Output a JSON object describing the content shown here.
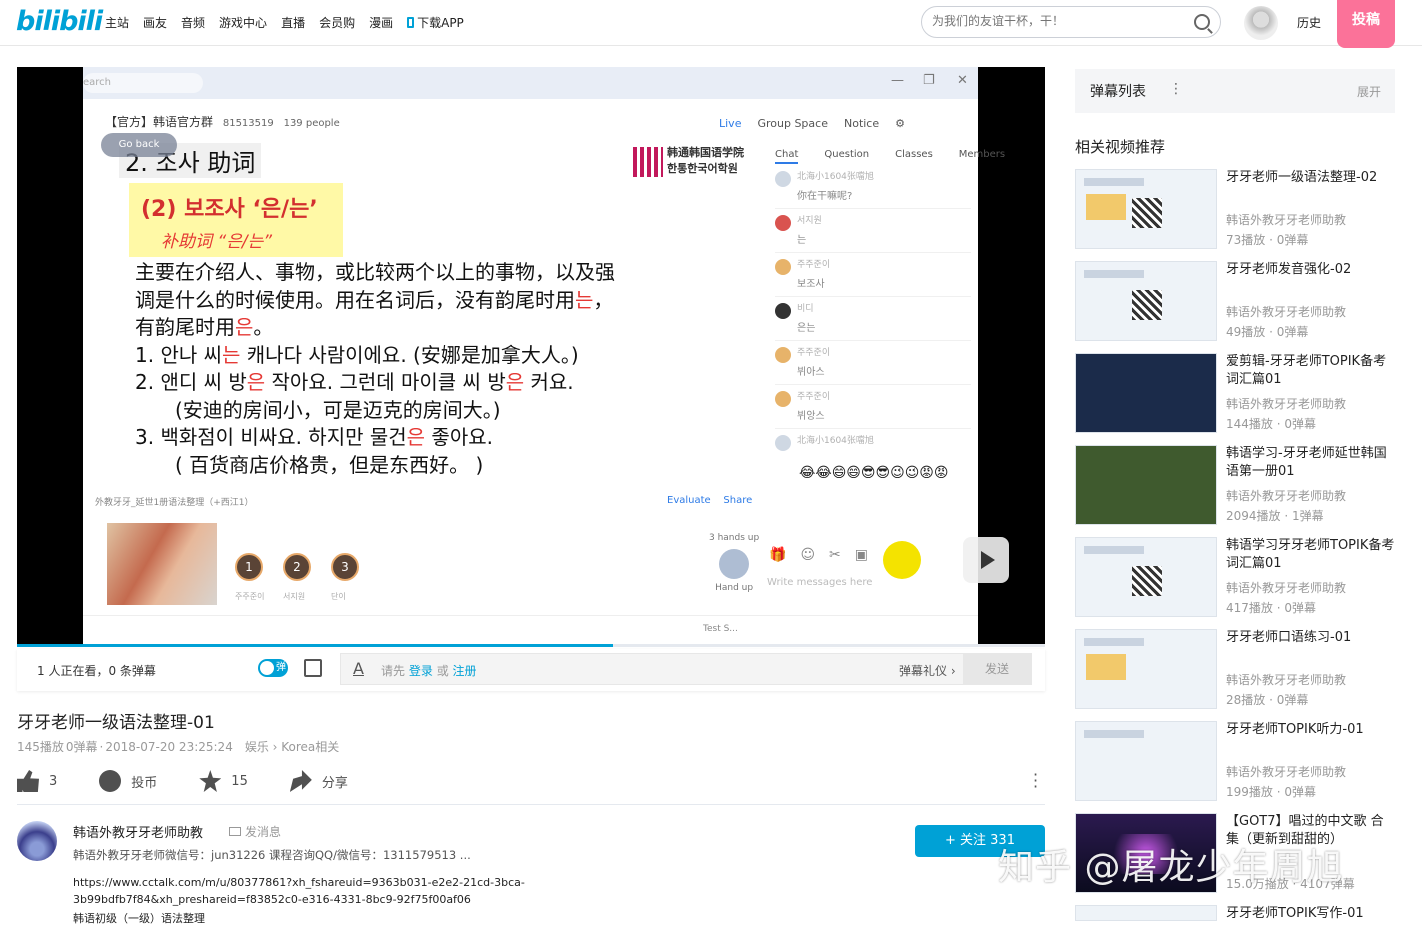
{
  "header": {
    "logo": "bilibili",
    "nav": [
      "主站",
      "画友",
      "音频",
      "游戏中心",
      "直播",
      "会员购",
      "漫画",
      "下载APP"
    ],
    "search_placeholder": "为我们的友谊干杯，干！",
    "history": "历史",
    "upload": "投稿"
  },
  "player": {
    "screen_search": "earch",
    "group_title": "【官方】韩语官方群",
    "group_id": "81513519",
    "group_people": "139 people",
    "go_back": "Go back",
    "right_tabs": [
      "Live",
      "Group Space",
      "Notice"
    ],
    "chat_tabs": [
      "Chat",
      "Question",
      "Classes",
      "Members"
    ],
    "chat": [
      {
        "name": "北海小1604张噹旭",
        "text": "你在干嘛呢?"
      },
      {
        "name": "서지원",
        "text": "는"
      },
      {
        "name": "주주준이",
        "text": "보조사"
      },
      {
        "name": "비디",
        "text": "은는"
      },
      {
        "name": "주주준이",
        "text": "뷔아스"
      },
      {
        "name": "주주준이",
        "text": "뷔앙스"
      },
      {
        "name": "北海小1604张噹旭",
        "text": ""
      }
    ],
    "emojis": "😂😂😄😄😎😎😉😉😡😡",
    "slide": {
      "heading": "2. 조사 助词",
      "logo": "韩通韩国语学院 한통한국어학원",
      "k1": "(2) 보조사 ‘은/는’",
      "k2": "补助词 “은/는”",
      "line1a": "主要在介绍人、事物，或比较两个以上的事物，以及强",
      "line1b": "调是什么的时候使用。用在名词后，没有韵尾时用",
      "line1b_red": "는",
      "line1b_end": "，",
      "line1c": "有韵尾时用",
      "line1c_red": "은",
      "line1c_end": "。",
      "ex1a": "1. 안나 씨",
      "ex1red": "는",
      "ex1b": " 캐나다 사람이에요. (安娜是加拿大人。)",
      "ex2a": "2. 앤디 씨 방",
      "ex2red": "은",
      "ex2b": " 작아요. 그런데 마이클 씨 방",
      "ex2red2": "은",
      "ex2c": " 커요.",
      "ex2cn": "(安迪的房间小，可是迈克的房间大。)",
      "ex3a": "3. 백화점이 비싸요. 하지만 물건",
      "ex3red": "은",
      "ex3b": " 좋아요.",
      "ex3cn": "( 百货商店价格贵，但是东西好。 )"
    },
    "footer_left": "外教牙牙_延世1册语法整理（+西江1）",
    "evaluate": "Evaluate",
    "share": "Share",
    "hands": [
      {
        "n": "1",
        "name": "주주준이"
      },
      {
        "n": "2",
        "name": "서지원"
      },
      {
        "n": "3",
        "name": "단이"
      }
    ],
    "hands_up_count": "3 hands up",
    "hand_up": "Hand up",
    "write_placeholder": "Write messages here",
    "test": "Test S...",
    "progress": 0.58
  },
  "sendbar": {
    "viewers": "1 人正在看，0 条弹幕",
    "toggle": "弹",
    "tip_prefix": "请先",
    "login": "登录",
    "or": "或",
    "register": "注册",
    "etiquette": "弹幕礼仪 ›",
    "send": "发送"
  },
  "video": {
    "title": "牙牙老师一级语法整理-01",
    "plays": "145播放",
    "danmaku": "0弹幕",
    "date": "2018-07-20 23:25:24",
    "category": "娱乐 › Korea相关",
    "like": "3",
    "coin": "投币",
    "fav": "15",
    "share": "分享"
  },
  "uploader": {
    "name": "韩语外教牙牙老师助教",
    "message": "发消息",
    "desc": "韩语外教牙牙老师微信号：jun31226 课程咨询QQ/微信号：1311579513 ...",
    "link1": "https://www.cctalk.com/m/u/80377861?xh_fshareuid=9363b031-e2e2-21cd-3bca-",
    "link2": "3b99bdfb7f84&xh_preshareid=f83852c0-e316-4331-8bc9-92f75f00af06",
    "link3": "韩语初级（一级）语法整理",
    "follow": "+  关注 331"
  },
  "sidebar": {
    "danmaku_title": "弹幕列表",
    "danmaku_more": "⋮",
    "expand": "展开",
    "related_title": "相关视频推荐",
    "related": [
      {
        "title": "牙牙老师一级语法整理-02",
        "author": "韩语外教牙牙老师助教",
        "stats": "73播放 · 0弹幕"
      },
      {
        "title": "牙牙老师发音强化-02",
        "author": "韩语外教牙牙老师助教",
        "stats": "49播放 · 0弹幕"
      },
      {
        "title": "爱剪辑-牙牙老师TOPIK备考词汇篇01",
        "author": "韩语外教牙牙老师助教",
        "stats": "144播放 · 0弹幕"
      },
      {
        "title": "韩语学习-牙牙老师延世韩国语第一册01",
        "author": "韩语外教牙牙老师助教",
        "stats": "2094播放 · 1弹幕"
      },
      {
        "title": "韩语学习牙牙老师TOPIK备考词汇篇01",
        "author": "韩语外教牙牙老师助教",
        "stats": "417播放 · 0弹幕"
      },
      {
        "title": "牙牙老师口语练习-01",
        "author": "韩语外教牙牙老师助教",
        "stats": "28播放 · 0弹幕"
      },
      {
        "title": "牙牙老师TOPIK听力-01",
        "author": "韩语外教牙牙老师助教",
        "stats": "199播放 · 0弹幕"
      },
      {
        "title": "【GOT7】唱过的中文歌 合集（更新到甜甜的）",
        "author": "",
        "stats": "15.0万播放 · 4107弹幕"
      },
      {
        "title": "牙牙老师TOPIK写作-01",
        "author": "",
        "stats": ""
      }
    ]
  },
  "watermark": "知乎 @屠龙少年周旭",
  "colors": {
    "accent": "#00a1d6",
    "upload": "#fb7299",
    "red_text": "#e53935"
  }
}
